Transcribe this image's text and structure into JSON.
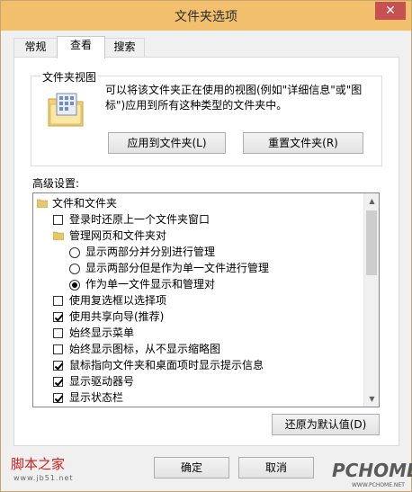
{
  "window": {
    "title": "文件夹选项",
    "close_glyph": "✕"
  },
  "tabs": [
    {
      "label": "常规"
    },
    {
      "label": "查看"
    },
    {
      "label": "搜索"
    }
  ],
  "folder_view": {
    "legend": "文件夹视图",
    "description": "可以将该文件夹正在使用的视图(例如\"详细信息\"或\"图标\")应用到所有这种类型的文件夹中。",
    "apply_button": "应用到文件夹(L)",
    "reset_button": "重置文件夹(R)"
  },
  "advanced": {
    "label": "高级设置:",
    "items": [
      {
        "type": "folder",
        "label": "文件和文件夹"
      },
      {
        "type": "checkbox",
        "checked": false,
        "label": "登录时还原上一个文件夹窗口"
      },
      {
        "type": "folder",
        "label": "管理网页和文件夹对"
      },
      {
        "type": "radio",
        "checked": false,
        "label": "显示两部分并分别进行管理"
      },
      {
        "type": "radio",
        "checked": false,
        "label": "显示两部分但是作为单一文件进行管理"
      },
      {
        "type": "radio",
        "checked": true,
        "label": "作为单一文件显示和管理对"
      },
      {
        "type": "checkbox",
        "checked": false,
        "label": "使用复选框以选择项"
      },
      {
        "type": "checkbox",
        "checked": true,
        "label": "使用共享向导(推荐)"
      },
      {
        "type": "checkbox",
        "checked": false,
        "label": "始终显示菜单"
      },
      {
        "type": "checkbox",
        "checked": false,
        "label": "始终显示图标，从不显示缩略图"
      },
      {
        "type": "checkbox",
        "checked": true,
        "label": "鼠标指向文件夹和桌面项时显示提示信息"
      },
      {
        "type": "checkbox",
        "checked": true,
        "label": "显示驱动器号"
      },
      {
        "type": "checkbox",
        "checked": true,
        "label": "显示状态栏"
      }
    ],
    "restore_defaults_button": "还原为默认值(D)"
  },
  "footer": {
    "ok_button": "确定",
    "cancel_button": "取消"
  },
  "watermarks": {
    "left_title": "脚本之家",
    "left_url": "www.jb51.net",
    "right_brand": "PCHOME",
    "right_url": "WWW.PCHOME.NET"
  },
  "colors": {
    "titlebar": "#f2c06c",
    "close": "#c75050",
    "folder": "#e8c66a"
  }
}
